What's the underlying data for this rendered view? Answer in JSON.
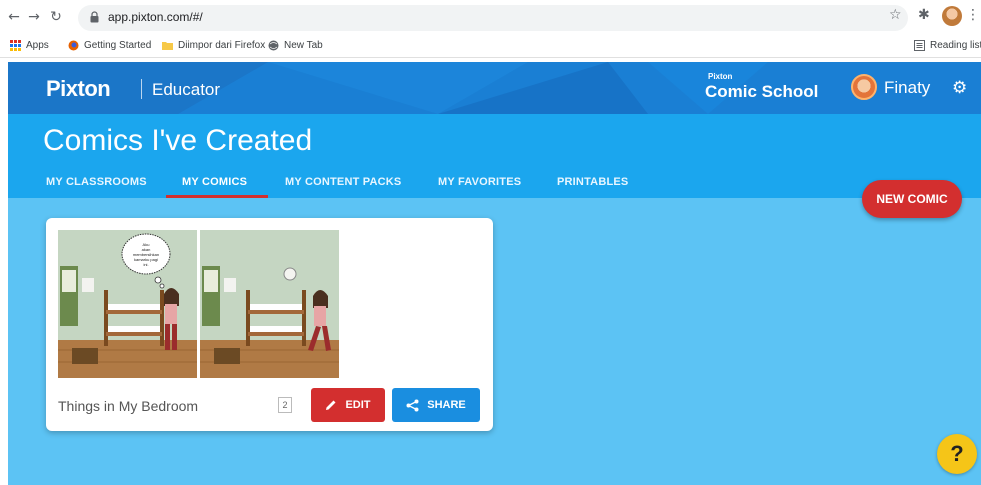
{
  "browser": {
    "url": "app.pixton.com/#/",
    "bookmarks": [
      "Apps",
      "Getting Started",
      "Diimpor dari Firefox",
      "New Tab"
    ],
    "reading_list": "Reading list"
  },
  "header": {
    "logo": "Pixton",
    "product": "Educator",
    "school_small": "Pixton",
    "school_big": "Comic School",
    "user_name": "Finaty"
  },
  "page": {
    "title": "Comics I've Created",
    "tabs": [
      "MY CLASSROOMS",
      "MY COMICS",
      "MY CONTENT PACKS",
      "MY FAVORITES",
      "PRINTABLES"
    ],
    "active_tab": "MY COMICS",
    "new_comic_label": "NEW COMIC"
  },
  "comic": {
    "title": "Things in My Bedroom",
    "panel_count": "2",
    "speech_bubble": "Aku akan membersihkan kamarku pagi ini.",
    "edit_label": "EDIT",
    "share_label": "SHARE"
  },
  "help": {
    "label": "?"
  },
  "colors": {
    "header_bg": "#1a7fd4",
    "title_bg": "#1ba6ee",
    "content_bg": "#5cc3f4",
    "accent_red": "#d32f2f",
    "share_blue": "#1a8ee0",
    "help_yellow": "#f5c518"
  }
}
